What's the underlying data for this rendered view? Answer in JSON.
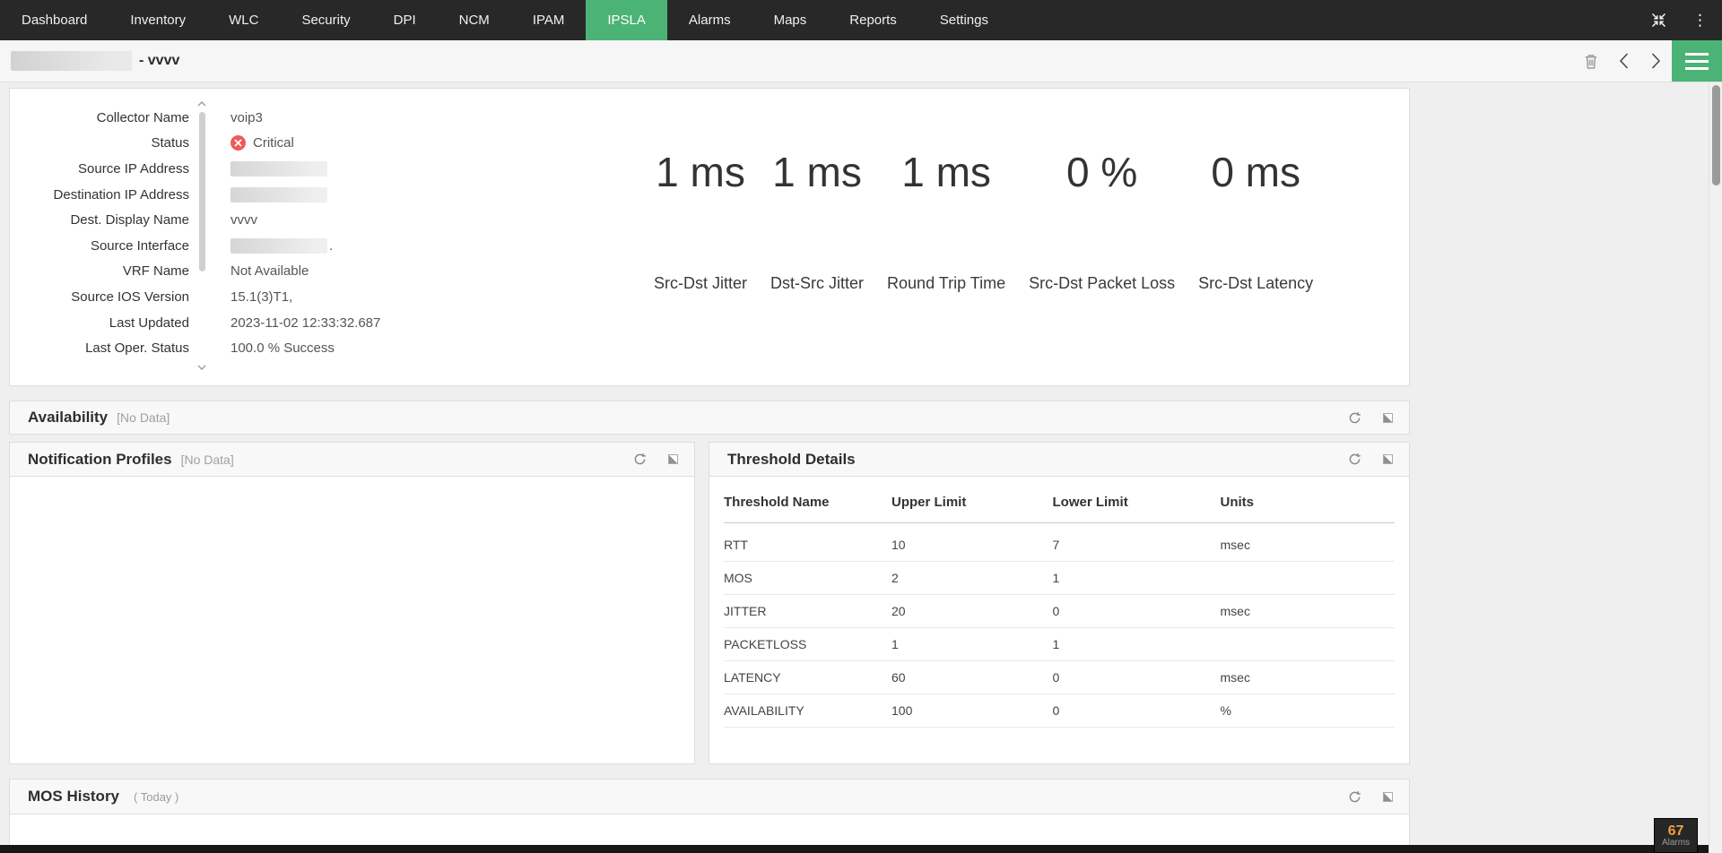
{
  "nav": {
    "items": [
      "Dashboard",
      "Inventory",
      "WLC",
      "Security",
      "DPI",
      "NCM",
      "IPAM",
      "IPSLA",
      "Alarms",
      "Maps",
      "Reports",
      "Settings"
    ],
    "active": "IPSLA"
  },
  "title_bar": {
    "title_suffix": "- vvvv"
  },
  "details": {
    "rows": [
      {
        "label": "Collector Name",
        "value": "voip3",
        "type": "text"
      },
      {
        "label": "Status",
        "value": "Critical",
        "type": "status"
      },
      {
        "label": "Source IP Address",
        "value": "",
        "type": "redacted"
      },
      {
        "label": "Destination IP Address",
        "value": "",
        "type": "redacted"
      },
      {
        "label": "Dest. Display Name",
        "value": "vvvv",
        "type": "text"
      },
      {
        "label": "Source Interface",
        "value": ".",
        "type": "redacted-dot"
      },
      {
        "label": "VRF Name",
        "value": "Not Available",
        "type": "text"
      },
      {
        "label": "Source IOS Version",
        "value": "15.1(3)T1,",
        "type": "text"
      },
      {
        "label": "Last Updated",
        "value": "2023-11-02 12:33:32.687",
        "type": "text"
      },
      {
        "label": "Last Oper. Status",
        "value": "100.0 % Success",
        "type": "text"
      }
    ]
  },
  "metrics": [
    {
      "value": "1 ms",
      "label": "Src-Dst Jitter"
    },
    {
      "value": "1 ms",
      "label": "Dst-Src Jitter"
    },
    {
      "value": "1 ms",
      "label": "Round Trip Time"
    },
    {
      "value": "0 %",
      "label": "Src-Dst Packet Loss"
    },
    {
      "value": "0 ms",
      "label": "Src-Dst Latency"
    }
  ],
  "sections": {
    "availability": {
      "title": "Availability",
      "no_data": "[No Data]"
    },
    "notification_profiles": {
      "title": "Notification Profiles",
      "no_data": "[No Data]"
    },
    "threshold_details": {
      "title": "Threshold Details"
    },
    "mos_history": {
      "title": "MOS History",
      "range": "( Today )"
    }
  },
  "threshold_table": {
    "columns": [
      "Threshold Name",
      "Upper Limit",
      "Lower Limit",
      "Units"
    ],
    "rows": [
      [
        "RTT",
        "10",
        "7",
        "msec"
      ],
      [
        "MOS",
        "2",
        "1",
        ""
      ],
      [
        "JITTER",
        "20",
        "0",
        "msec"
      ],
      [
        "PACKETLOSS",
        "1",
        "1",
        ""
      ],
      [
        "LATENCY",
        "60",
        "0",
        "msec"
      ],
      [
        "AVAILABILITY",
        "100",
        "0",
        "%"
      ]
    ]
  },
  "alarms_badge": {
    "count": "67",
    "label": "Alarms"
  },
  "colors": {
    "accent_green": "#4cb376",
    "status_critical": "#ee5a5a",
    "alarm_count": "#f09d3c"
  },
  "icons": [
    "collapse-icon",
    "kebab-menu-icon",
    "trash-icon",
    "chevron-left-icon",
    "chevron-right-icon",
    "hamburger-menu-icon",
    "refresh-icon",
    "expand-icon",
    "circle-x-icon",
    "scroll-up-icon",
    "scroll-down-icon"
  ]
}
